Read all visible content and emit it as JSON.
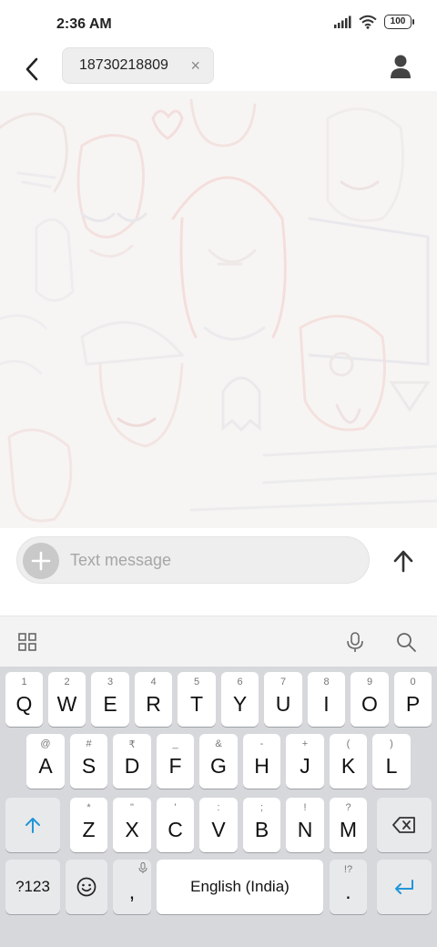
{
  "status_bar": {
    "time": "2:36 AM",
    "battery": "100"
  },
  "header": {
    "recipient": "18730218809",
    "clear_glyph": "×"
  },
  "composer": {
    "placeholder": "Text message",
    "attach_glyph": "+"
  },
  "keyboard": {
    "row1": [
      {
        "key": "Q",
        "hint": "1"
      },
      {
        "key": "W",
        "hint": "2"
      },
      {
        "key": "E",
        "hint": "3"
      },
      {
        "key": "R",
        "hint": "4"
      },
      {
        "key": "T",
        "hint": "5"
      },
      {
        "key": "Y",
        "hint": "6"
      },
      {
        "key": "U",
        "hint": "7"
      },
      {
        "key": "I",
        "hint": "8"
      },
      {
        "key": "O",
        "hint": "9"
      },
      {
        "key": "P",
        "hint": "0"
      }
    ],
    "row2": [
      {
        "key": "A",
        "hint": "@"
      },
      {
        "key": "S",
        "hint": "#"
      },
      {
        "key": "D",
        "hint": "₹"
      },
      {
        "key": "F",
        "hint": "_"
      },
      {
        "key": "G",
        "hint": "&"
      },
      {
        "key": "H",
        "hint": "-"
      },
      {
        "key": "J",
        "hint": "+"
      },
      {
        "key": "K",
        "hint": "("
      },
      {
        "key": "L",
        "hint": ")"
      }
    ],
    "row3": [
      {
        "key": "Z",
        "hint": "*"
      },
      {
        "key": "X",
        "hint": "\""
      },
      {
        "key": "C",
        "hint": "'"
      },
      {
        "key": "V",
        "hint": ":"
      },
      {
        "key": "B",
        "hint": ";"
      },
      {
        "key": "N",
        "hint": "!"
      },
      {
        "key": "M",
        "hint": "?"
      }
    ],
    "symbols_label": "?123",
    "comma": ",",
    "space_label": "English (India)",
    "period": ".",
    "period_hint": "!?"
  },
  "colors": {
    "accent": "#2196d9",
    "keyboard_bg": "#d6d8dc",
    "conversation_bg": "#f7f5f4"
  }
}
